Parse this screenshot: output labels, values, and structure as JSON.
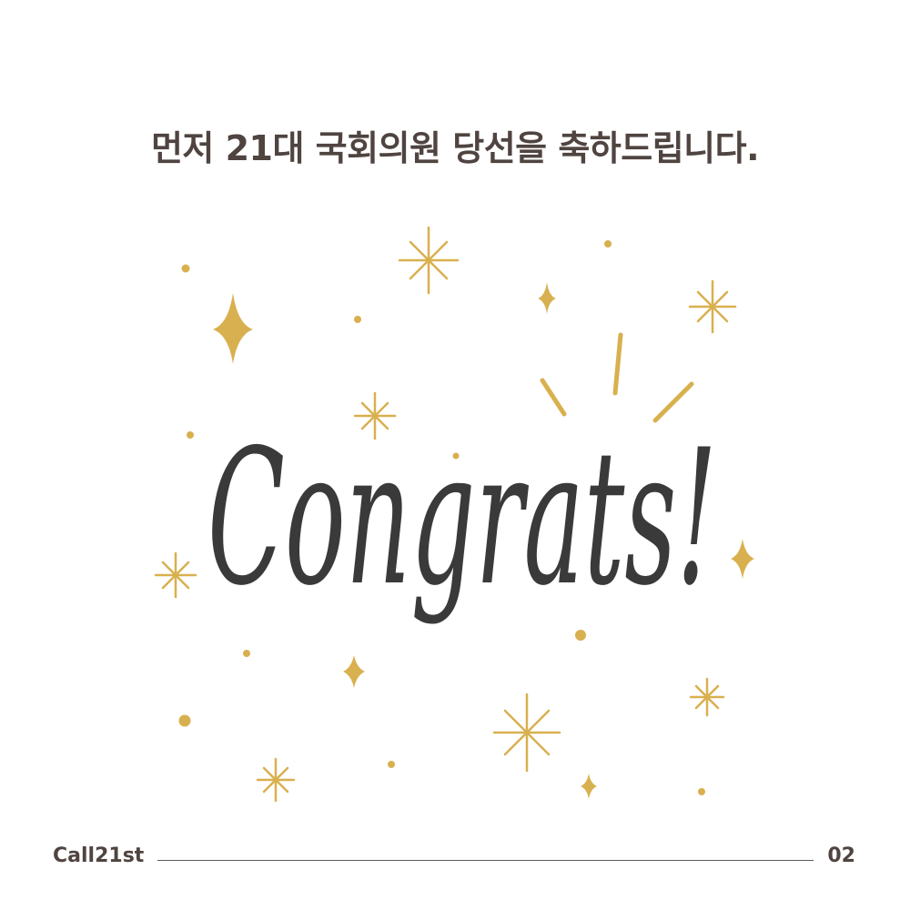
{
  "headline": "먼저 21대 국회의원 당선을 축하드립니다.",
  "artwork": {
    "text": "Congrats!",
    "text_color": "#3a3a3a",
    "accent_color": "#d9b04f"
  },
  "footer": {
    "brand": "Call21st",
    "page_number": "02"
  }
}
